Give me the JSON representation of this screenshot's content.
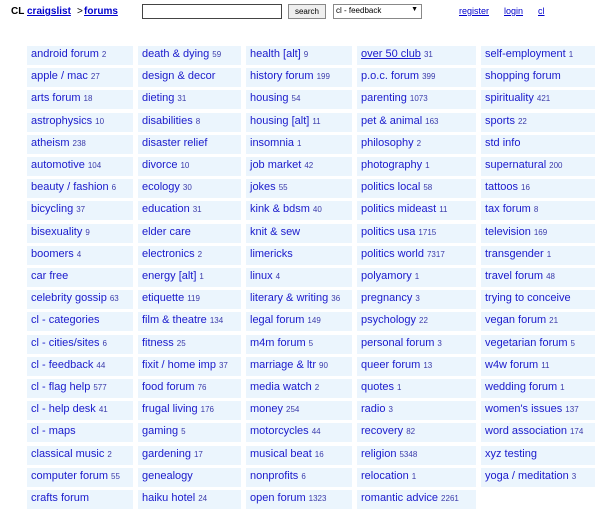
{
  "header": {
    "logo": "CL",
    "breadcrumb": {
      "site": "craigslist",
      "separator": ">",
      "section": "forums"
    },
    "search": {
      "value": "",
      "placeholder": "",
      "button_label": "search"
    },
    "forum_select": {
      "selected": "cl - feedback"
    },
    "links": {
      "register": "register",
      "login": "login",
      "cl": "cl"
    }
  },
  "columns": [
    [
      {
        "name": "android forum",
        "count": "2"
      },
      {
        "name": "apple / mac",
        "count": "27"
      },
      {
        "name": "arts forum",
        "count": "18"
      },
      {
        "name": "astrophysics",
        "count": "10"
      },
      {
        "name": "atheism",
        "count": "238"
      },
      {
        "name": "automotive",
        "count": "104"
      },
      {
        "name": "beauty / fashion",
        "count": "6"
      },
      {
        "name": "bicycling",
        "count": "37"
      },
      {
        "name": "bisexuality",
        "count": "9"
      },
      {
        "name": "boomers",
        "count": "4"
      },
      {
        "name": "car free",
        "count": ""
      },
      {
        "name": "celebrity gossip",
        "count": "63"
      },
      {
        "name": "cl - categories",
        "count": ""
      },
      {
        "name": "cl - cities/sites",
        "count": "6"
      },
      {
        "name": "cl - feedback",
        "count": "44"
      },
      {
        "name": "cl - flag help",
        "count": "577"
      },
      {
        "name": "cl - help desk",
        "count": "41"
      },
      {
        "name": "cl - maps",
        "count": ""
      },
      {
        "name": "classical music",
        "count": "2"
      },
      {
        "name": "computer forum",
        "count": "55"
      },
      {
        "name": "crafts forum",
        "count": ""
      }
    ],
    [
      {
        "name": "death & dying",
        "count": "59"
      },
      {
        "name": "design & decor",
        "count": ""
      },
      {
        "name": "dieting",
        "count": "31"
      },
      {
        "name": "disabilities",
        "count": "8"
      },
      {
        "name": "disaster relief",
        "count": ""
      },
      {
        "name": "divorce",
        "count": "10"
      },
      {
        "name": "ecology",
        "count": "30"
      },
      {
        "name": "education",
        "count": "31"
      },
      {
        "name": "elder care",
        "count": ""
      },
      {
        "name": "electronics",
        "count": "2"
      },
      {
        "name": "energy [alt]",
        "count": "1"
      },
      {
        "name": "etiquette",
        "count": "119"
      },
      {
        "name": "film & theatre",
        "count": "134"
      },
      {
        "name": "fitness",
        "count": "25"
      },
      {
        "name": "fixit / home imp",
        "count": "37"
      },
      {
        "name": "food forum",
        "count": "76"
      },
      {
        "name": "frugal living",
        "count": "176"
      },
      {
        "name": "gaming",
        "count": "5"
      },
      {
        "name": "gardening",
        "count": "17"
      },
      {
        "name": "genealogy",
        "count": ""
      },
      {
        "name": "haiku hotel",
        "count": "24"
      }
    ],
    [
      {
        "name": "health [alt]",
        "count": "9"
      },
      {
        "name": "history forum",
        "count": "199"
      },
      {
        "name": "housing",
        "count": "54"
      },
      {
        "name": "housing [alt]",
        "count": "11"
      },
      {
        "name": "insomnia",
        "count": "1"
      },
      {
        "name": "job market",
        "count": "42"
      },
      {
        "name": "jokes",
        "count": "55"
      },
      {
        "name": "kink & bdsm",
        "count": "40"
      },
      {
        "name": "knit & sew",
        "count": ""
      },
      {
        "name": "limericks",
        "count": ""
      },
      {
        "name": "linux",
        "count": "4"
      },
      {
        "name": "literary & writing",
        "count": "36"
      },
      {
        "name": "legal forum",
        "count": "149"
      },
      {
        "name": "m4m forum",
        "count": "5"
      },
      {
        "name": "marriage & ltr",
        "count": "90"
      },
      {
        "name": "media watch",
        "count": "2"
      },
      {
        "name": "money",
        "count": "254"
      },
      {
        "name": "motorcycles",
        "count": "44"
      },
      {
        "name": "musical beat",
        "count": "16"
      },
      {
        "name": "nonprofits",
        "count": "6"
      },
      {
        "name": "open forum",
        "count": "1323"
      }
    ],
    [
      {
        "name": "over 50 club",
        "count": "31",
        "underlined": true
      },
      {
        "name": "p.o.c. forum",
        "count": "399"
      },
      {
        "name": "parenting",
        "count": "1073"
      },
      {
        "name": "pet & animal",
        "count": "163"
      },
      {
        "name": "philosophy",
        "count": "2"
      },
      {
        "name": "photography",
        "count": "1"
      },
      {
        "name": "politics local",
        "count": "58"
      },
      {
        "name": "politics mideast",
        "count": "11"
      },
      {
        "name": "politics usa",
        "count": "1715"
      },
      {
        "name": "politics world",
        "count": "7317"
      },
      {
        "name": "polyamory",
        "count": "1"
      },
      {
        "name": "pregnancy",
        "count": "3"
      },
      {
        "name": "psychology",
        "count": "22"
      },
      {
        "name": "personal forum",
        "count": "3"
      },
      {
        "name": "queer forum",
        "count": "13"
      },
      {
        "name": "quotes",
        "count": "1"
      },
      {
        "name": "radio",
        "count": "3"
      },
      {
        "name": "recovery",
        "count": "82"
      },
      {
        "name": "religion",
        "count": "5348"
      },
      {
        "name": "relocation",
        "count": "1"
      },
      {
        "name": "romantic advice",
        "count": "2261"
      }
    ],
    [
      {
        "name": "self-employment",
        "count": "1"
      },
      {
        "name": "shopping forum",
        "count": ""
      },
      {
        "name": "spirituality",
        "count": "421"
      },
      {
        "name": "sports",
        "count": "22"
      },
      {
        "name": "std info",
        "count": ""
      },
      {
        "name": "supernatural",
        "count": "200"
      },
      {
        "name": "tattoos",
        "count": "16"
      },
      {
        "name": "tax forum",
        "count": "8"
      },
      {
        "name": "television",
        "count": "169"
      },
      {
        "name": "transgender",
        "count": "1"
      },
      {
        "name": "travel forum",
        "count": "48"
      },
      {
        "name": "trying to conceive",
        "count": ""
      },
      {
        "name": "vegan forum",
        "count": "21"
      },
      {
        "name": "vegetarian forum",
        "count": "5"
      },
      {
        "name": "w4w forum",
        "count": "11"
      },
      {
        "name": "wedding forum",
        "count": "1"
      },
      {
        "name": "women's issues",
        "count": "137"
      },
      {
        "name": "word association",
        "count": "174"
      },
      {
        "name": "xyz testing",
        "count": ""
      },
      {
        "name": "yoga / meditation",
        "count": "3"
      }
    ]
  ]
}
